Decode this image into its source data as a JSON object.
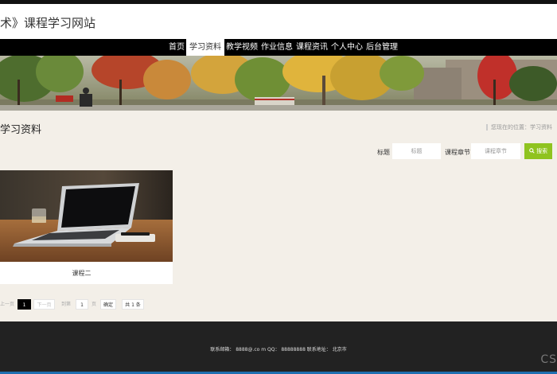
{
  "header": {
    "title": "术》课程学习网站"
  },
  "nav": {
    "items": [
      {
        "label": "首页",
        "active": false
      },
      {
        "label": "学习资料",
        "active": true
      },
      {
        "label": "教学视频",
        "active": false
      },
      {
        "label": "作业信息",
        "active": false
      },
      {
        "label": "课程资讯",
        "active": false
      },
      {
        "label": "个人中心",
        "active": false
      },
      {
        "label": "后台管理",
        "active": false
      }
    ]
  },
  "page": {
    "title": "学习资料",
    "breadcrumb": "您现在的位置：学习资料"
  },
  "search": {
    "title_label": "标题",
    "title_placeholder": "标题",
    "chapter_label": "课程章节",
    "chapter_placeholder": "课程章节",
    "button_label": "搜索",
    "button_icon": "search-icon"
  },
  "cards": [
    {
      "title": "课程二"
    }
  ],
  "pager": {
    "prev": "上一页",
    "current": "1",
    "next": "下一页",
    "goto_label": "到第",
    "goto_value": "1",
    "page_unit": "页",
    "confirm": "确定",
    "total": "共 1 条"
  },
  "footer": {
    "contact": "联系邮箱：  8888@.co m QQ：  88888888  联系地址：  北京市"
  },
  "watermark": "CS",
  "colors": {
    "nav_bg": "#000000",
    "search_button": "#8fc31f",
    "footer_bg": "#222222",
    "page_bg": "#f3efe8"
  }
}
